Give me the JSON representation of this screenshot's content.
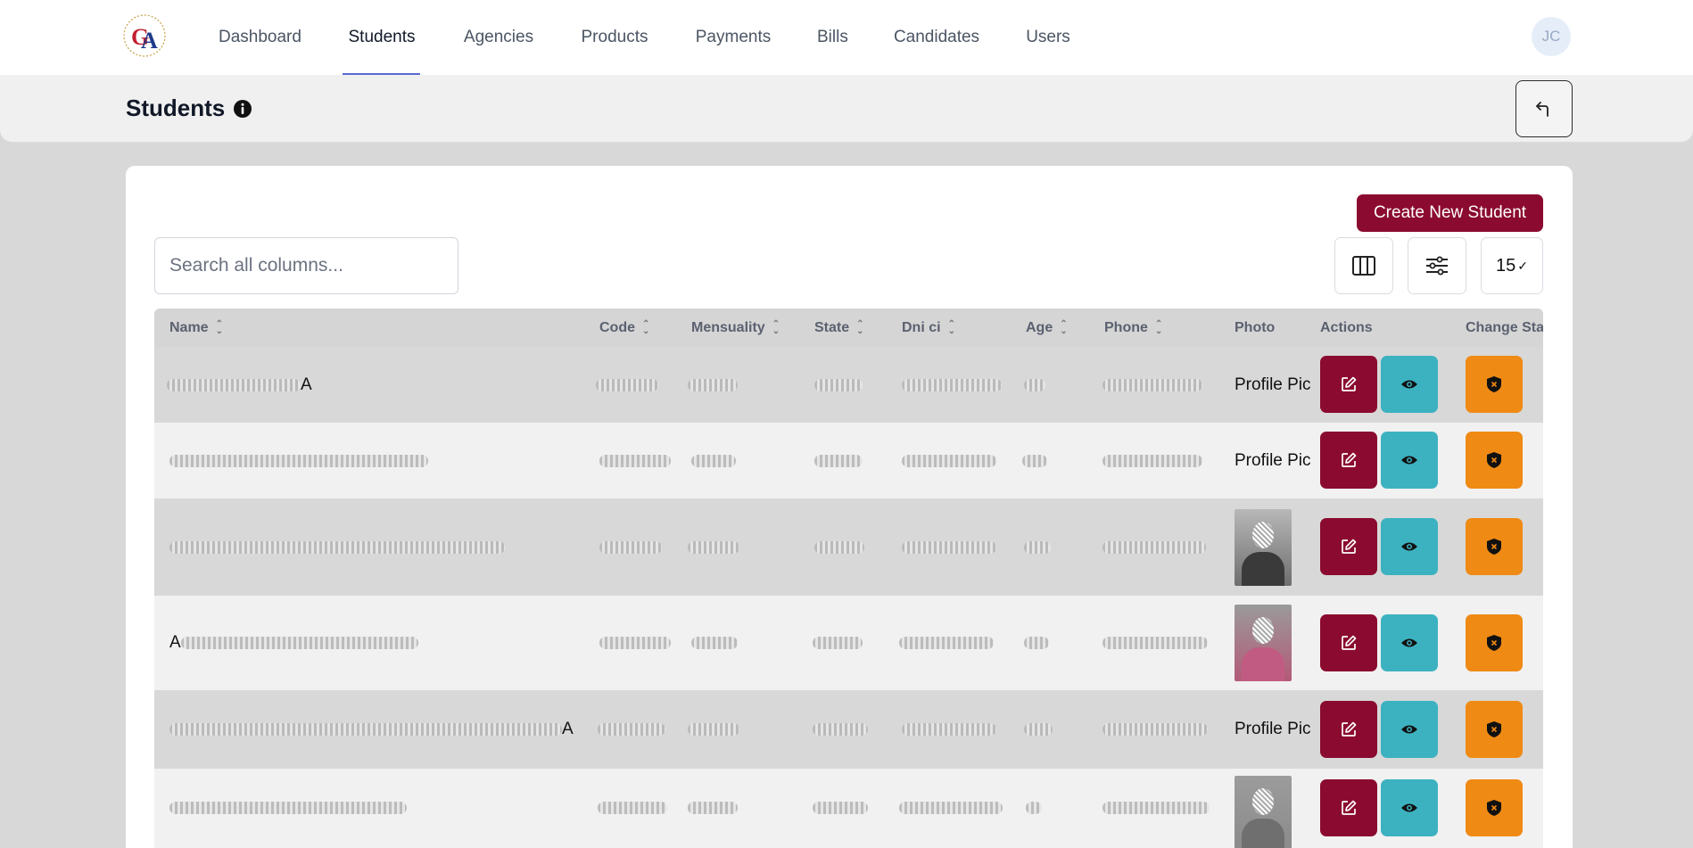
{
  "nav": {
    "items": [
      "Dashboard",
      "Students",
      "Agencies",
      "Products",
      "Payments",
      "Bills",
      "Candidates",
      "Users"
    ],
    "active": "Students",
    "avatar_initials": "JC"
  },
  "header": {
    "title": "Students"
  },
  "toolbar": {
    "create_label": "Create New Student",
    "search_placeholder": "Search all columns...",
    "page_size": "15"
  },
  "table": {
    "columns": [
      "Name",
      "Code",
      "Mensuality",
      "State",
      "Dni ci",
      "Age",
      "Phone",
      "Photo",
      "Actions",
      "Change Stat"
    ],
    "photo_placeholder": "Profile Pic",
    "rows": [
      {
        "name_visible": "A",
        "photo": "Profile Pic"
      },
      {
        "name_visible": "",
        "photo": "Profile Pic"
      },
      {
        "name_visible": "",
        "photo": "image"
      },
      {
        "name_visible": "A",
        "photo": "image"
      },
      {
        "name_visible": "A",
        "photo": "Profile Pic"
      },
      {
        "name_visible": "",
        "photo": "image"
      }
    ]
  },
  "colors": {
    "brand": "#8b0a2f",
    "view": "#3cb2c0",
    "change_state": "#ef8a14",
    "nav_underline": "#5b6ad0"
  },
  "icons": {
    "edit": "edit-icon",
    "view": "eye-icon",
    "change_state": "shield-x-icon",
    "columns": "columns-icon",
    "filter": "sliders-icon",
    "back": "back-arrow-icon",
    "info": "info-icon"
  }
}
